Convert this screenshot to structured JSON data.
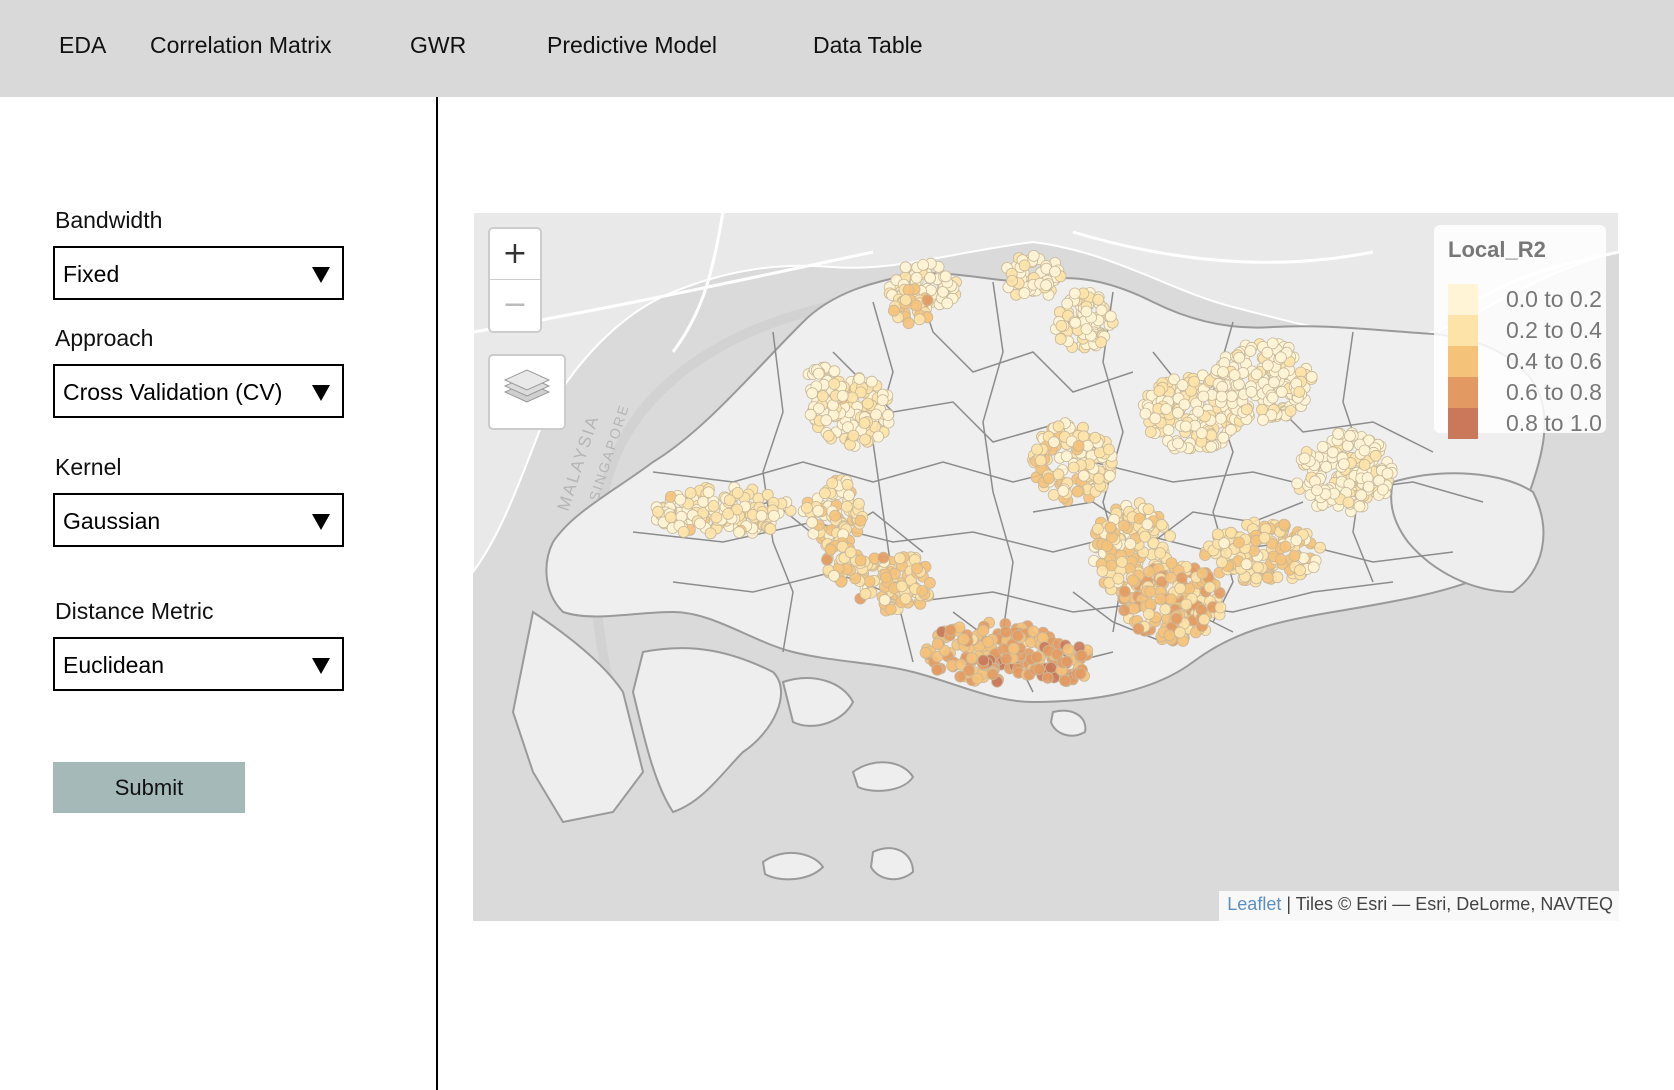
{
  "nav": {
    "tabs": [
      {
        "label": "EDA"
      },
      {
        "label": "Correlation Matrix"
      },
      {
        "label": "GWR"
      },
      {
        "label": "Predictive Model"
      },
      {
        "label": "Data Table"
      }
    ]
  },
  "sidebar": {
    "bandwidth": {
      "label": "Bandwidth",
      "value": "Fixed"
    },
    "approach": {
      "label": "Approach",
      "value": "Cross Validation (CV)"
    },
    "kernel": {
      "label": "Kernel",
      "value": "Gaussian"
    },
    "distance": {
      "label": "Distance Metric",
      "value": "Euclidean"
    },
    "submit_label": "Submit"
  },
  "map": {
    "zoom_in": "+",
    "zoom_out": "−",
    "map_labels": [
      "MALAYSIA",
      "SINGAPORE"
    ],
    "legend": {
      "title": "Local_R2",
      "items": [
        {
          "label": "0.0 to 0.2",
          "color": "#fff5d6"
        },
        {
          "label": "0.2 to 0.4",
          "color": "#fde3a8"
        },
        {
          "label": "0.4 to 0.6",
          "color": "#f5c27a"
        },
        {
          "label": "0.6 to 0.8",
          "color": "#e39a62"
        },
        {
          "label": "0.8 to 1.0",
          "color": "#c9785a"
        }
      ]
    },
    "attribution": {
      "link": "Leaflet",
      "text": " | Tiles © Esri — Esri, DeLorme, NAVTEQ"
    }
  },
  "colors": {
    "topbar": "#d9d9d9",
    "submit": "#a5b9b9",
    "map_bg": "#dcdcdc",
    "land": "#efefef"
  }
}
